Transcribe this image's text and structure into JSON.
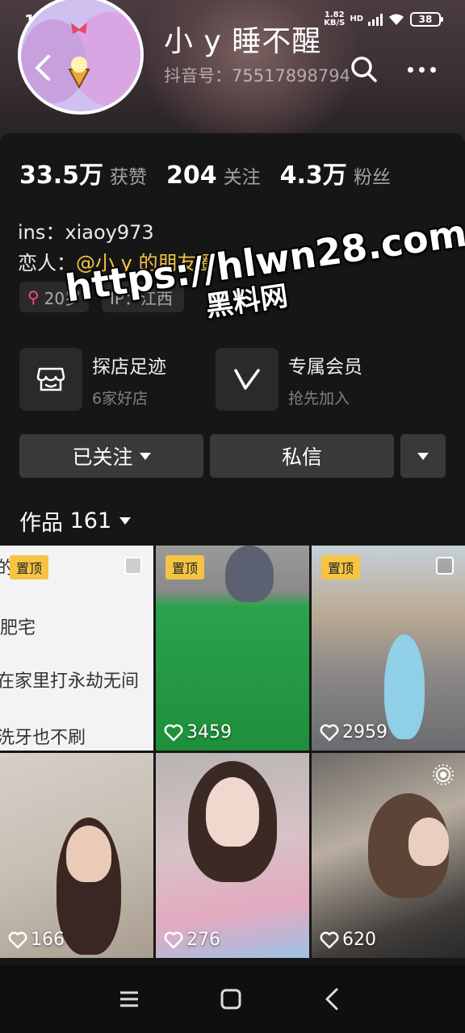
{
  "status_bar": {
    "time": "1:46",
    "net_speed_value": "1.82",
    "net_speed_unit": "KB/S",
    "network_type": "HD",
    "battery": "38"
  },
  "header": {
    "name": "小 y 睡不醒",
    "douyin_id": "抖音号：75517898794"
  },
  "stats": [
    {
      "value": "33.5万",
      "label": "获赞"
    },
    {
      "value": "204",
      "label": "关注"
    },
    {
      "value": "4.3万",
      "label": "粉丝"
    }
  ],
  "bio": {
    "line1": "ins：xiaoy973",
    "line2_prefix": "恋人：",
    "line2_mention": "@小 y 的朋友圈"
  },
  "tags": {
    "age": "20岁",
    "ip": "IP：江西"
  },
  "watermark": {
    "url": "https://hlwn28.com",
    "site": "黑料网"
  },
  "features": {
    "store": {
      "title": "探店足迹",
      "subtitle": "6家好店"
    },
    "vip": {
      "title": "专属会员",
      "subtitle": "抢先加入"
    }
  },
  "actions": {
    "follow": "已关注",
    "message": "私信"
  },
  "works": {
    "label": "作品",
    "count": "161"
  },
  "grid": [
    {
      "pinned": "置顶",
      "likes": "",
      "lines": [
        "的",
        "肥宅",
        "在家里打永劫无间",
        "洗牙也不刷"
      ]
    },
    {
      "pinned": "置顶",
      "likes": "3459"
    },
    {
      "pinned": "置顶",
      "likes": "2959"
    },
    {
      "likes": "166"
    },
    {
      "likes": "276"
    },
    {
      "likes": "620"
    }
  ],
  "colors": {
    "accent": "#f5c443",
    "female": "#ff4d8b",
    "panel": "#161616",
    "button": "#393939"
  }
}
